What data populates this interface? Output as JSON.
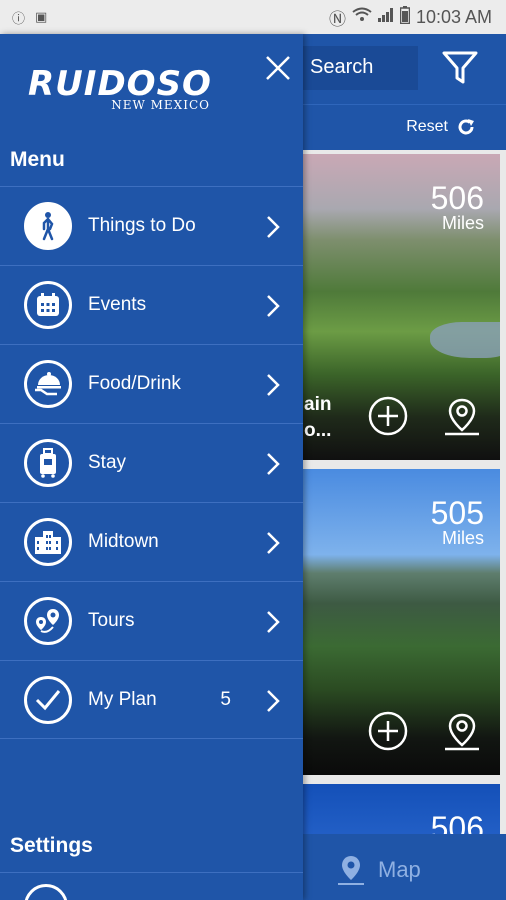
{
  "status_bar": {
    "time": "10:03 AM",
    "left_icons": [
      "info-icon",
      "image-icon"
    ],
    "right_icons": [
      "nfc-icon",
      "wifi-icon",
      "signal-icon",
      "battery-icon"
    ]
  },
  "topbar": {
    "search_label": "Search",
    "reset_label": "Reset"
  },
  "cards": [
    {
      "distance": "506",
      "unit": "Miles",
      "title_line1": "ain",
      "title_line2": "o..."
    },
    {
      "distance": "505",
      "unit": "Miles"
    },
    {
      "distance": "506"
    }
  ],
  "map_bar": {
    "label": "Map"
  },
  "drawer": {
    "logo_main": "RUIDOSO",
    "logo_sub": "NEW MEXICO",
    "menu_heading": "Menu",
    "settings_heading": "Settings",
    "items": [
      {
        "label": "Things to Do",
        "icon": "person-walking-icon"
      },
      {
        "label": "Events",
        "icon": "calendar-icon"
      },
      {
        "label": "Food/Drink",
        "icon": "food-cloche-icon"
      },
      {
        "label": "Stay",
        "icon": "luggage-icon"
      },
      {
        "label": "Midtown",
        "icon": "building-icon"
      },
      {
        "label": "Tours",
        "icon": "map-pins-icon"
      },
      {
        "label": "My Plan",
        "icon": "checkmark-icon",
        "count": "5"
      }
    ]
  },
  "colors": {
    "brand_blue": "#1f55a8",
    "divider": "#3d6fc0",
    "status_bar": "#ececec"
  }
}
